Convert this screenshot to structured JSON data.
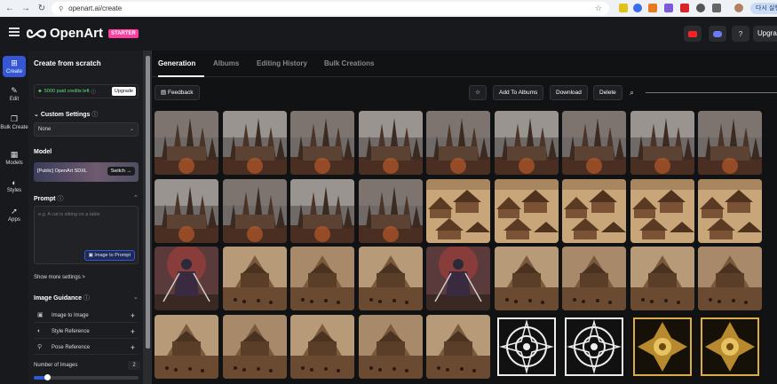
{
  "browser": {
    "url": "openart.ai/create",
    "profile_label": "다시 실행"
  },
  "header": {
    "logo_text": "OpenArt",
    "plan_badge": "STARTER",
    "upgrade_label": "Upgra"
  },
  "rail": {
    "items": [
      {
        "label": "Create",
        "icon": "plus-square-icon"
      },
      {
        "label": "Edit",
        "icon": "edit-icon"
      },
      {
        "label": "Bulk Create",
        "icon": "bulk-icon"
      },
      {
        "label": "Models",
        "icon": "grid-icon"
      },
      {
        "label": "Styles",
        "icon": "palette-icon"
      },
      {
        "label": "Apps",
        "icon": "rocket-icon"
      }
    ]
  },
  "panel": {
    "title": "Create from scratch",
    "credits_text": "5000 paid credits left",
    "credits_upgrade": "Upgrade",
    "custom_settings_label": "Custom Settings",
    "custom_settings_value": "None",
    "model_label": "Model",
    "model_name": "[Public] OpenArt SDXL",
    "model_switch": "Switch →",
    "prompt_label": "Prompt",
    "prompt_placeholder": "e.g. A cat is sitting on a table",
    "image_to_prompt": "Image to Prompt",
    "show_more": "Show more settings >",
    "guidance_label": "Image Guidance",
    "guidance_items": [
      "Image to Image",
      "Style Reference",
      "Pose Reference"
    ],
    "num_images_label": "Number of Images",
    "num_images_value": "2"
  },
  "tabs": [
    "Generation",
    "Albums",
    "Editing History",
    "Bulk Creations"
  ],
  "toolbar": {
    "feedback": "Feedback",
    "add_to_albums": "Add To Albums",
    "download": "Download",
    "delete": "Delete"
  },
  "colors": {
    "accent": "#3457d5",
    "credits_green": "#5ee07a",
    "starter_pink": "#ff3ca0"
  },
  "gallery": {
    "rows": [
      [
        "castle",
        "castle",
        "castle",
        "castle",
        "castle",
        "castle",
        "castle",
        "castle",
        "castle"
      ],
      [
        "castle",
        "castle",
        "castle",
        "castle",
        "village",
        "village",
        "village",
        "village",
        "village"
      ],
      [
        "warrior",
        "temple",
        "temple",
        "temple",
        "warrior",
        "temple",
        "temple",
        "temple",
        "temple"
      ],
      [
        "temple",
        "temple",
        "temple",
        "temple",
        "temple",
        "pattern-white",
        "pattern-white",
        "pattern-gold",
        "pattern-gold"
      ]
    ]
  }
}
